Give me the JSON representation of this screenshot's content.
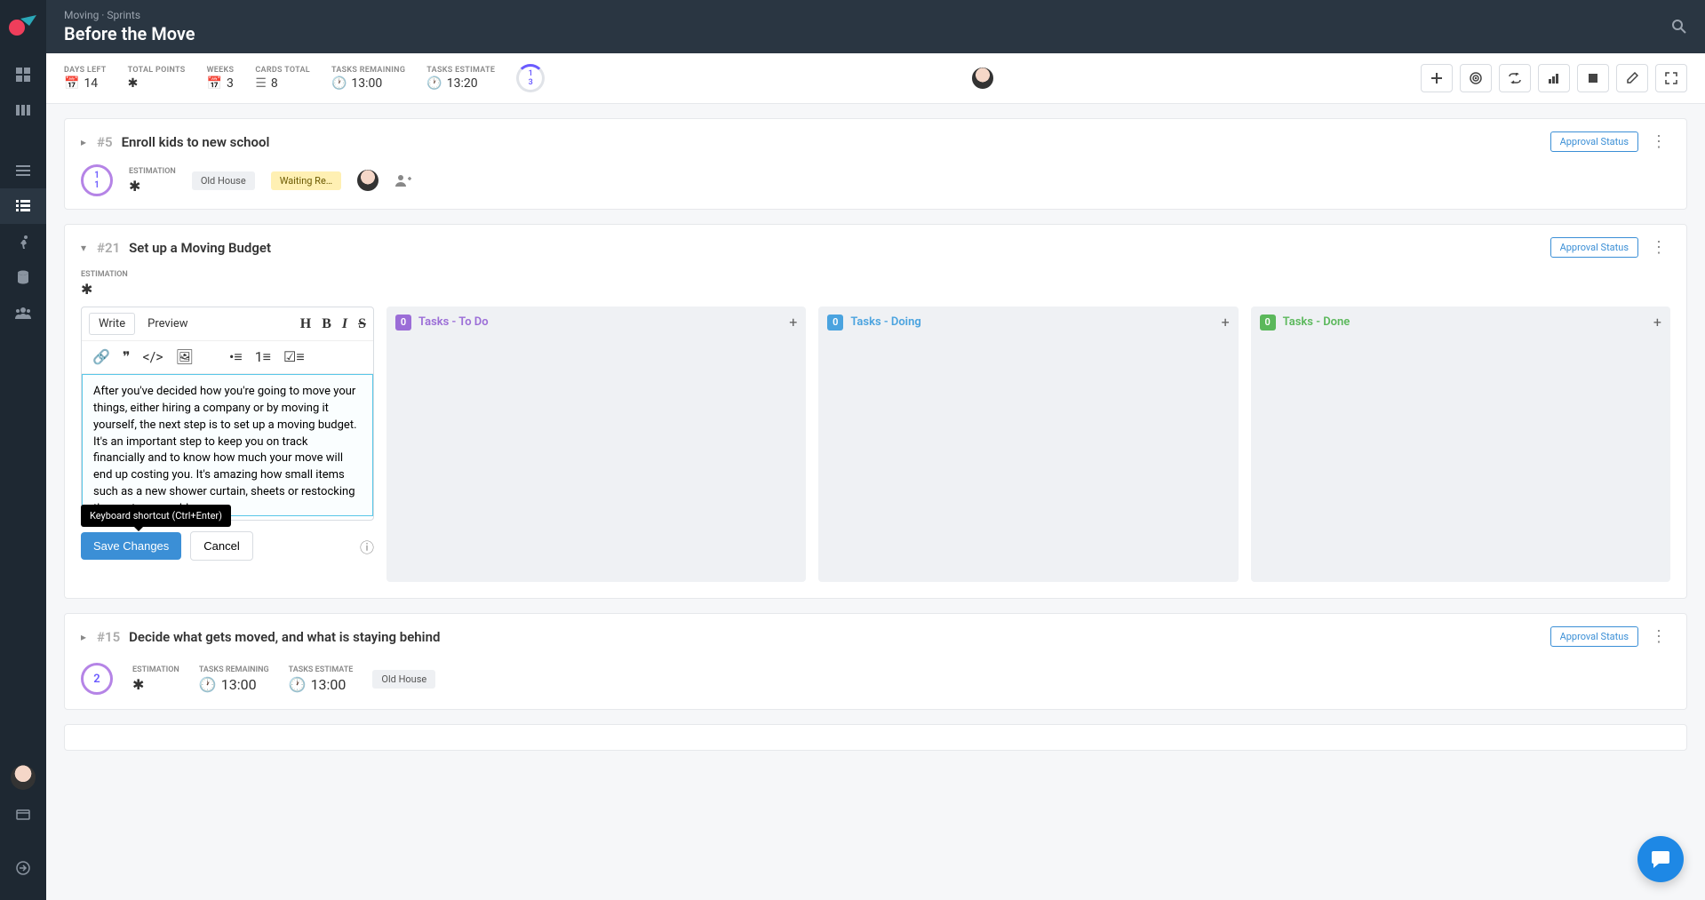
{
  "breadcrumb": "Moving · Sprints",
  "page_title": "Before the Move",
  "stats": {
    "days_left": {
      "label": "DAYS LEFT",
      "value": "14"
    },
    "total_points": {
      "label": "TOTAL POINTS",
      "value": "✱"
    },
    "weeks": {
      "label": "WEEKS",
      "value": "3"
    },
    "cards_total": {
      "label": "CARDS TOTAL",
      "value": "8"
    },
    "tasks_remaining": {
      "label": "TASKS REMAINING",
      "value": "13:00"
    },
    "tasks_estimate": {
      "label": "TASKS ESTIMATE",
      "value": "13:20"
    },
    "ring_top": "1",
    "ring_bottom": "3"
  },
  "approval_label": "Approval Status",
  "estimation_label": "ESTIMATION",
  "card1": {
    "num": "#5",
    "title": "Enroll kids to new school",
    "badge_top": "1",
    "badge_bottom": "1",
    "tag1": "Old House",
    "tag2": "Waiting Re…"
  },
  "card2": {
    "num": "#21",
    "title": "Set up a Moving Budget",
    "tabs": {
      "write": "Write",
      "preview": "Preview"
    },
    "text_value": "After you've decided how you're going to move your things, either hiring a company or by moving it yourself, the next step is to set up a moving budget. It's an important step to keep you on track financially and to know how much your move will end up costing you. It's amazing how small items such as a new shower curtain, sheets or restocking the pantry can add up.",
    "tooltip": "Keyboard shortcut (Ctrl+Enter)",
    "save": "Save Changes",
    "cancel": "Cancel",
    "columns": {
      "todo": {
        "count": "0",
        "title": "Tasks - To Do"
      },
      "doing": {
        "count": "0",
        "title": "Tasks - Doing"
      },
      "done": {
        "count": "0",
        "title": "Tasks - Done"
      }
    }
  },
  "card3": {
    "num": "#15",
    "title": "Decide what gets moved, and what is staying behind",
    "badge": "2",
    "tasks_remaining_label": "TASKS REMAINING",
    "tasks_remaining_value": "13:00",
    "tasks_estimate_label": "TASKS ESTIMATE",
    "tasks_estimate_value": "13:00",
    "tag": "Old House"
  }
}
